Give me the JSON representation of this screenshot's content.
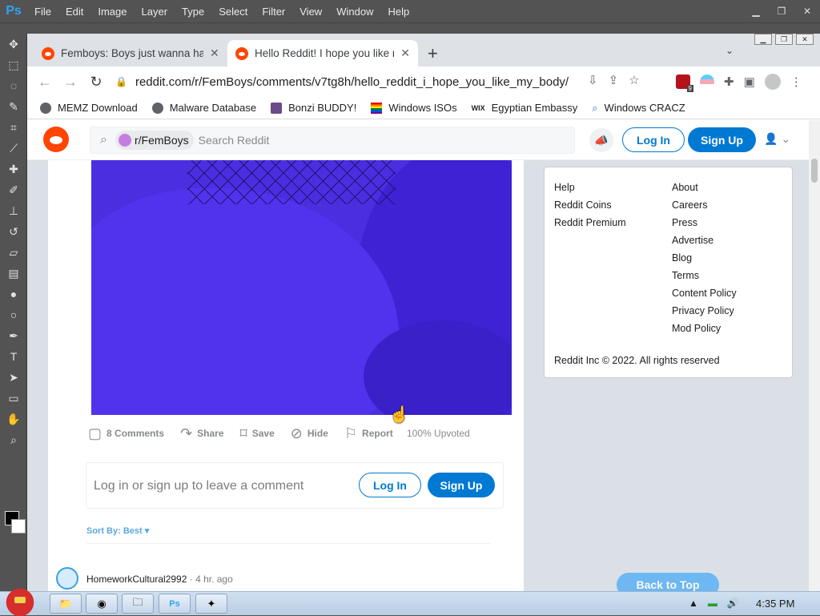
{
  "photoshop": {
    "logo": "Ps",
    "menu": [
      "File",
      "Edit",
      "Image",
      "Layer",
      "Type",
      "Select",
      "Filter",
      "View",
      "Window",
      "Help"
    ]
  },
  "browser": {
    "tabs": [
      {
        "title": "Femboys: Boys just wanna hav",
        "close": "✕"
      },
      {
        "title": "Hello Reddit! I hope you like r",
        "close": "✕"
      }
    ],
    "new_tab": "+",
    "url": "reddit.com/r/FemBoys/comments/v7tg8h/hello_reddit_i_hope_you_like_my_body/",
    "extension_badge": "9",
    "bookmarks": [
      {
        "label": "MEMZ Download",
        "icon": "globe-icon"
      },
      {
        "label": "Malware Database",
        "icon": "globe-icon"
      },
      {
        "label": "Bonzi BUDDY!",
        "icon": "bonzi-icon"
      },
      {
        "label": "Windows ISOs",
        "icon": "rainbow-flag-icon"
      },
      {
        "label": "Egyptian Embassy",
        "icon": "wix-icon"
      },
      {
        "label": "Windows CRACZ",
        "icon": "search-icon"
      }
    ],
    "wix_text": "WIX"
  },
  "reddit": {
    "subreddit_chip": "r/FemBoys",
    "search_placeholder": "Search Reddit",
    "login": "Log In",
    "signup": "Sign Up",
    "actions": {
      "comments": "8 Comments",
      "share": "Share",
      "save": "Save",
      "hide": "Hide",
      "report": "Report",
      "upvoted": "100% Upvoted"
    },
    "comment_prompt": "Log in or sign up to leave a comment",
    "sort_by": "Sort By: Best",
    "comment": {
      "user": "HomeworkCultural2992",
      "sep": " · ",
      "ago": "4 hr. ago"
    },
    "sidebar": {
      "col1": [
        "Help",
        "Reddit Coins",
        "Reddit Premium"
      ],
      "col2": [
        "About",
        "Careers",
        "Press",
        "Advertise",
        "Blog",
        "Terms",
        "Content Policy",
        "Privacy Policy",
        "Mod Policy"
      ],
      "copyright": "Reddit Inc © 2022. All rights reserved"
    },
    "back_to_top": "Back to Top"
  },
  "taskbar": {
    "clock": "4:35 PM"
  },
  "colors": {
    "reddit_orange": "#ff4500",
    "reddit_blue": "#0079d3",
    "media_purple": "#4a2ee0"
  }
}
